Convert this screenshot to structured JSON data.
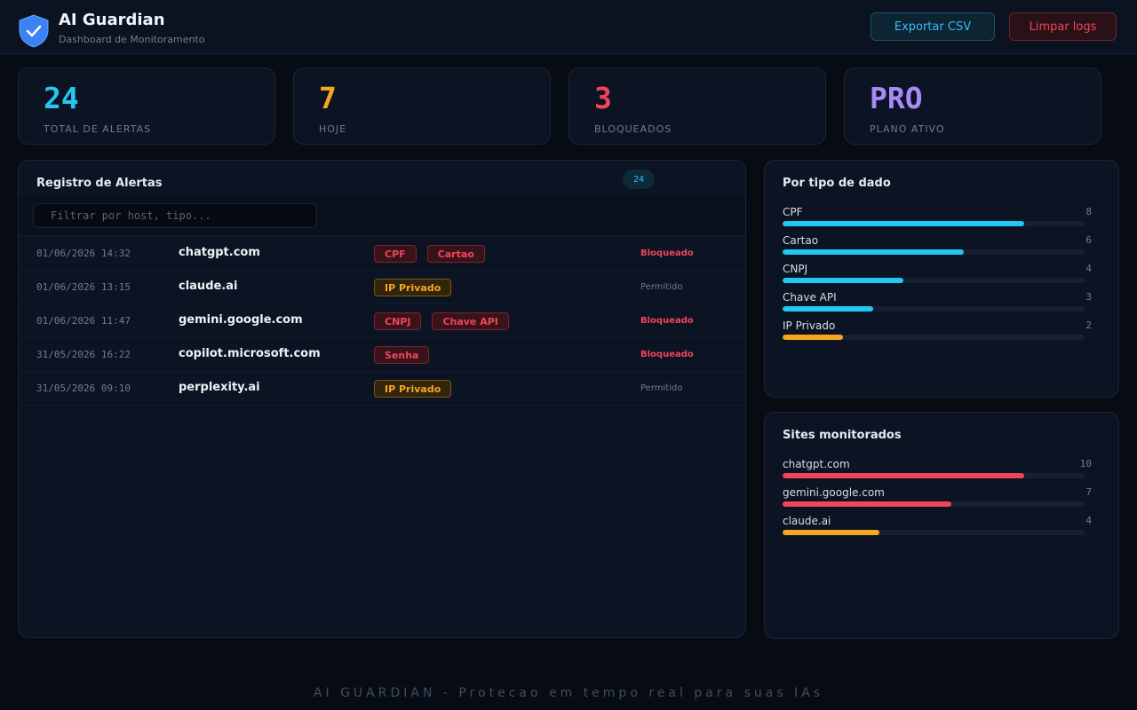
{
  "app": {
    "title": "AI Guardian",
    "subtitle": "Dashboard de Monitoramento"
  },
  "header": {
    "export_label": "Exportar CSV",
    "clear_label": "Limpar logs"
  },
  "stats": [
    {
      "value": "24",
      "label": "TOTAL DE ALERTAS",
      "color": "#22c8f0"
    },
    {
      "value": "7",
      "label": "HOJE",
      "color": "#f5a623"
    },
    {
      "value": "3",
      "label": "BLOQUEADOS",
      "color": "#f0455a"
    },
    {
      "value": "PRO",
      "label": "PLANO ATIVO",
      "color": "#a78bfa"
    }
  ],
  "log": {
    "title": "Registro de Alertas",
    "count": "24",
    "filter_placeholder": "Filtrar por host, tipo...",
    "rows": [
      {
        "time": "01/06/2026 14:32",
        "host": "chatgpt.com",
        "tags": [
          {
            "label": "CPF",
            "tone": "red"
          },
          {
            "label": "Cartao",
            "tone": "red"
          }
        ],
        "status": "Bloqueado",
        "blocked": true
      },
      {
        "time": "01/06/2026 13:15",
        "host": "claude.ai",
        "tags": [
          {
            "label": "IP Privado",
            "tone": "amber"
          }
        ],
        "status": "Permitido",
        "blocked": false
      },
      {
        "time": "01/06/2026 11:47",
        "host": "gemini.google.com",
        "tags": [
          {
            "label": "CNPJ",
            "tone": "red"
          },
          {
            "label": "Chave API",
            "tone": "red"
          }
        ],
        "status": "Bloqueado",
        "blocked": true
      },
      {
        "time": "31/05/2026 16:22",
        "host": "copilot.microsoft.com",
        "tags": [
          {
            "label": "Senha",
            "tone": "red"
          }
        ],
        "status": "Bloqueado",
        "blocked": true
      },
      {
        "time": "31/05/2026 09:10",
        "host": "perplexity.ai",
        "tags": [
          {
            "label": "IP Privado",
            "tone": "amber"
          }
        ],
        "status": "Permitido",
        "blocked": false
      }
    ]
  },
  "by_type": {
    "title": "Por tipo de dado",
    "max": 10,
    "items": [
      {
        "label": "CPF",
        "value": 8,
        "color": "#22c8f0"
      },
      {
        "label": "Cartao",
        "value": 6,
        "color": "#22c8f0"
      },
      {
        "label": "CNPJ",
        "value": 4,
        "color": "#22c8f0"
      },
      {
        "label": "Chave API",
        "value": 3,
        "color": "#22c8f0"
      },
      {
        "label": "IP Privado",
        "value": 2,
        "color": "#f5a623"
      }
    ]
  },
  "sites": {
    "title": "Sites monitorados",
    "max": 12.5,
    "items": [
      {
        "label": "chatgpt.com",
        "value": 10,
        "color": "#f0455a"
      },
      {
        "label": "gemini.google.com",
        "value": 7,
        "color": "#f0455a"
      },
      {
        "label": "claude.ai",
        "value": 4,
        "color": "#f5a623"
      }
    ]
  },
  "footer": {
    "text": "AI GUARDIAN - Protecao em tempo real para suas IAs"
  }
}
